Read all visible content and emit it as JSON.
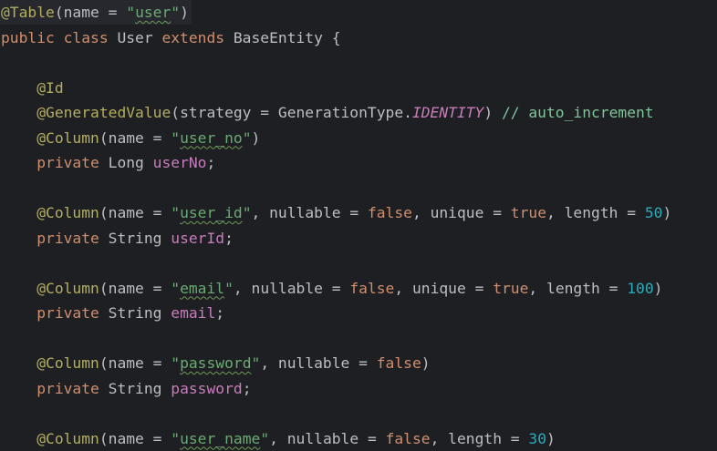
{
  "editor": {
    "lines": [
      [
        {
          "t": "@Table",
          "c": "annotation"
        },
        {
          "t": "(name = ",
          "c": "plain"
        },
        {
          "t": "\"",
          "c": "string"
        },
        {
          "t": "user",
          "c": "string typo"
        },
        {
          "t": "\"",
          "c": "string"
        },
        {
          "t": ")",
          "c": "plain"
        }
      ],
      [
        {
          "t": "public class ",
          "c": "keyword"
        },
        {
          "t": "User ",
          "c": "plain"
        },
        {
          "t": "extends ",
          "c": "keyword"
        },
        {
          "t": "BaseEntity {",
          "c": "plain"
        }
      ],
      [],
      [
        {
          "t": "    ",
          "c": "plain"
        },
        {
          "t": "@Id",
          "c": "annotation"
        }
      ],
      [
        {
          "t": "    ",
          "c": "plain"
        },
        {
          "t": "@GeneratedValue",
          "c": "annotation"
        },
        {
          "t": "(strategy = GenerationType.",
          "c": "plain"
        },
        {
          "t": "IDENTITY",
          "c": "static-field"
        },
        {
          "t": ") ",
          "c": "plain"
        },
        {
          "t": "// auto_increment",
          "c": "comment"
        }
      ],
      [
        {
          "t": "    ",
          "c": "plain"
        },
        {
          "t": "@Column",
          "c": "annotation"
        },
        {
          "t": "(name = ",
          "c": "plain"
        },
        {
          "t": "\"",
          "c": "string"
        },
        {
          "t": "user_no",
          "c": "string typo"
        },
        {
          "t": "\"",
          "c": "string"
        },
        {
          "t": ")",
          "c": "plain"
        }
      ],
      [
        {
          "t": "    ",
          "c": "plain"
        },
        {
          "t": "private ",
          "c": "keyword"
        },
        {
          "t": "Long ",
          "c": "plain"
        },
        {
          "t": "userNo",
          "c": "field"
        },
        {
          "t": ";",
          "c": "plain"
        }
      ],
      [],
      [
        {
          "t": "    ",
          "c": "plain"
        },
        {
          "t": "@Column",
          "c": "annotation"
        },
        {
          "t": "(name = ",
          "c": "plain"
        },
        {
          "t": "\"",
          "c": "string"
        },
        {
          "t": "user_id",
          "c": "string typo"
        },
        {
          "t": "\"",
          "c": "string"
        },
        {
          "t": ", nullable = ",
          "c": "plain"
        },
        {
          "t": "false",
          "c": "keyword"
        },
        {
          "t": ", unique = ",
          "c": "plain"
        },
        {
          "t": "true",
          "c": "keyword"
        },
        {
          "t": ", length = ",
          "c": "plain"
        },
        {
          "t": "50",
          "c": "number"
        },
        {
          "t": ")",
          "c": "plain"
        }
      ],
      [
        {
          "t": "    ",
          "c": "plain"
        },
        {
          "t": "private ",
          "c": "keyword"
        },
        {
          "t": "String ",
          "c": "plain"
        },
        {
          "t": "userId",
          "c": "field"
        },
        {
          "t": ";",
          "c": "plain"
        }
      ],
      [],
      [
        {
          "t": "    ",
          "c": "plain"
        },
        {
          "t": "@Column",
          "c": "annotation"
        },
        {
          "t": "(name = ",
          "c": "plain"
        },
        {
          "t": "\"",
          "c": "string"
        },
        {
          "t": "email",
          "c": "string typo"
        },
        {
          "t": "\"",
          "c": "string"
        },
        {
          "t": ", nullable = ",
          "c": "plain"
        },
        {
          "t": "false",
          "c": "keyword"
        },
        {
          "t": ", unique = ",
          "c": "plain"
        },
        {
          "t": "true",
          "c": "keyword"
        },
        {
          "t": ", length = ",
          "c": "plain"
        },
        {
          "t": "100",
          "c": "number"
        },
        {
          "t": ")",
          "c": "plain"
        }
      ],
      [
        {
          "t": "    ",
          "c": "plain"
        },
        {
          "t": "private ",
          "c": "keyword"
        },
        {
          "t": "String ",
          "c": "plain"
        },
        {
          "t": "email",
          "c": "field"
        },
        {
          "t": ";",
          "c": "plain"
        }
      ],
      [],
      [
        {
          "t": "    ",
          "c": "plain"
        },
        {
          "t": "@Column",
          "c": "annotation"
        },
        {
          "t": "(name = ",
          "c": "plain"
        },
        {
          "t": "\"",
          "c": "string"
        },
        {
          "t": "password",
          "c": "string typo"
        },
        {
          "t": "\"",
          "c": "string"
        },
        {
          "t": ", nullable = ",
          "c": "plain"
        },
        {
          "t": "false",
          "c": "keyword"
        },
        {
          "t": ")",
          "c": "plain"
        }
      ],
      [
        {
          "t": "    ",
          "c": "plain"
        },
        {
          "t": "private ",
          "c": "keyword"
        },
        {
          "t": "String ",
          "c": "plain"
        },
        {
          "t": "password",
          "c": "field"
        },
        {
          "t": ";",
          "c": "plain"
        }
      ],
      [],
      [
        {
          "t": "    ",
          "c": "plain"
        },
        {
          "t": "@Column",
          "c": "annotation"
        },
        {
          "t": "(name = ",
          "c": "plain"
        },
        {
          "t": "\"",
          "c": "string"
        },
        {
          "t": "user_name",
          "c": "string typo"
        },
        {
          "t": "\"",
          "c": "string"
        },
        {
          "t": ", nullable = ",
          "c": "plain"
        },
        {
          "t": "false",
          "c": "keyword"
        },
        {
          "t": ", length = ",
          "c": "plain"
        },
        {
          "t": "30",
          "c": "number"
        },
        {
          "t": ")",
          "c": "plain"
        }
      ]
    ]
  },
  "colors": {
    "background": "#1e1f22",
    "current_line": "#26282e",
    "annotation": "#b3ae60",
    "keyword": "#cf8e6d",
    "string": "#6aab73",
    "number": "#2aacb8",
    "field": "#c77dbb",
    "comment": "#7ec699",
    "plain": "#bcbec4"
  }
}
